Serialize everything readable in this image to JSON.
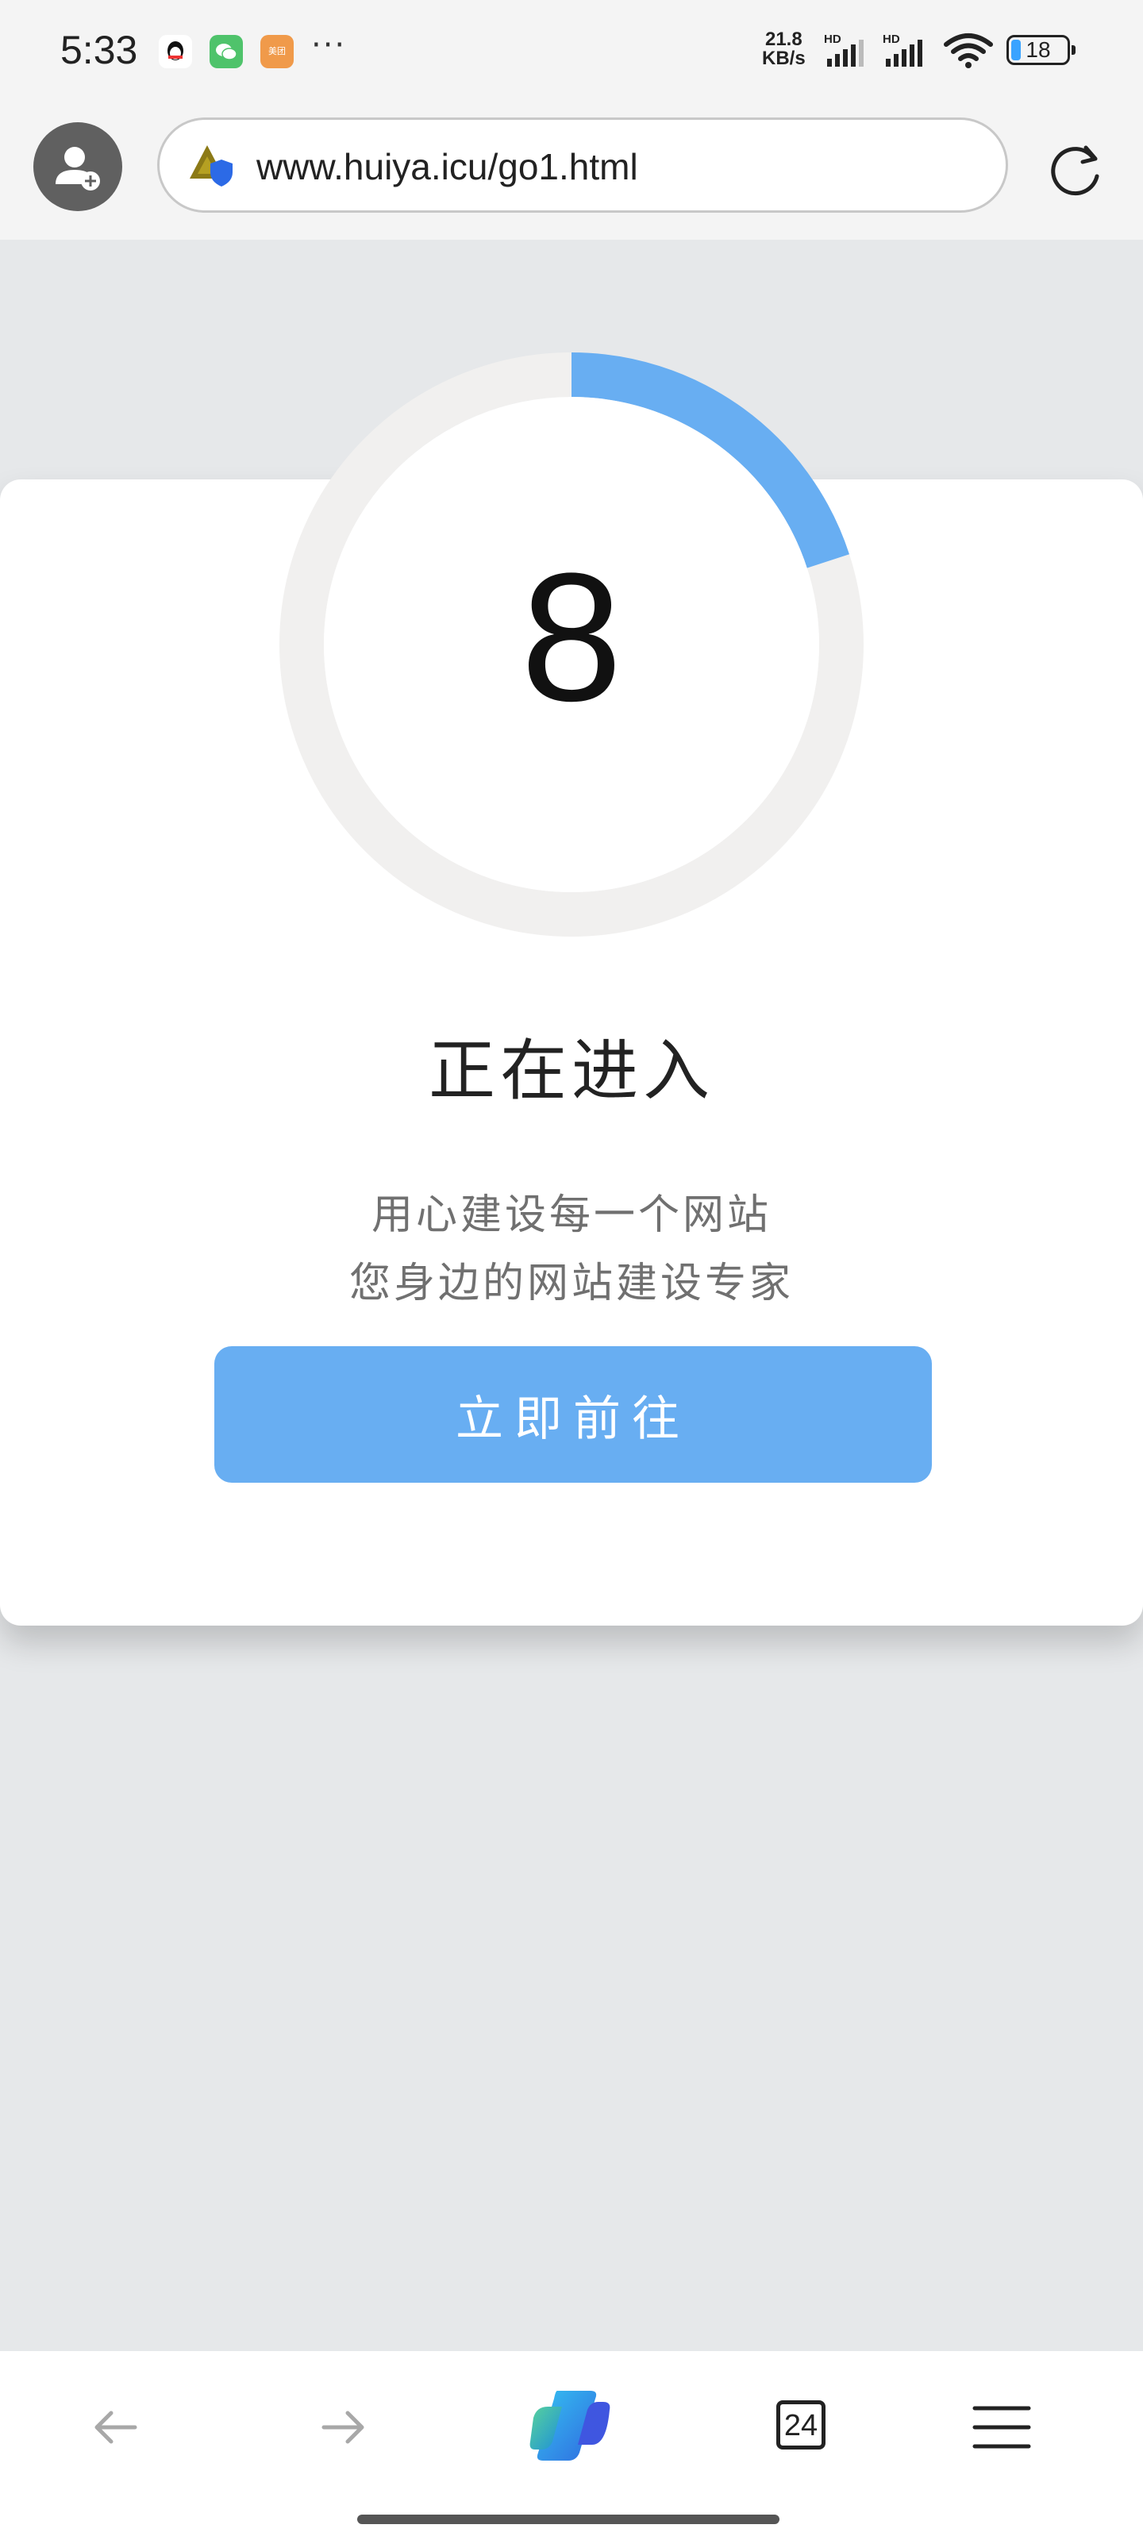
{
  "status_bar": {
    "time": "5:33",
    "notification_icons": [
      "qq-icon",
      "wechat-icon",
      "meituan-icon"
    ],
    "meituan_label": "美团",
    "more_label": "···",
    "net_speed_value": "21.8",
    "net_speed_unit": "KB/s",
    "hd_label": "HD",
    "battery_level": "18"
  },
  "browser": {
    "url": "www.huiya.icu/go1.html",
    "tab_count": "24"
  },
  "page": {
    "countdown": "8",
    "progress_fraction": 0.2,
    "heading": "正在进入",
    "subtitle_line1": "用心建设每一个网站",
    "subtitle_line2": "您身边的网站建设专家",
    "button_label": "立即前往"
  },
  "colors": {
    "accent": "#68aef2",
    "ring_track": "#f1f0ef",
    "page_background": "#e6e8ea"
  }
}
